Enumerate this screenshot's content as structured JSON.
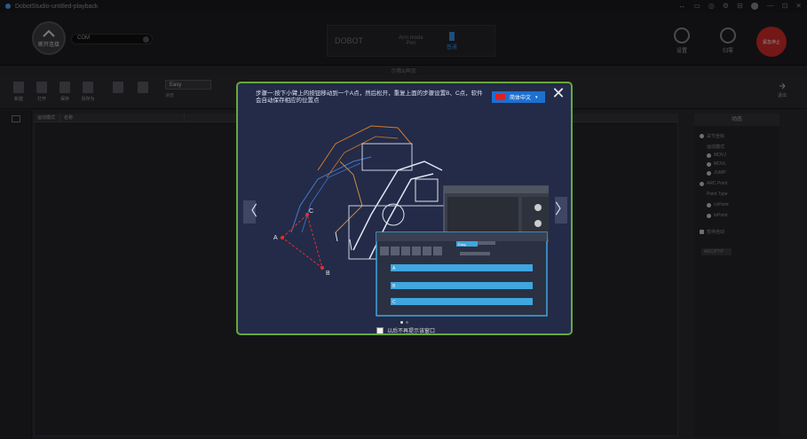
{
  "window": {
    "title": "DobotStudio-untitled-playback",
    "controls": [
      "↔",
      "▭",
      "◎",
      "⚙",
      "⊟",
      "⬤",
      "—",
      "⊡",
      "✕"
    ]
  },
  "topbar": {
    "connect_label": "断开连接",
    "port_value": "COM",
    "device_logo": "DOBOT",
    "mode_label": "Arm mode",
    "mode_value": "Pen",
    "arm_label": "普通",
    "settings_label": "设置",
    "home_label": "归零",
    "estop_label": "紧急停止",
    "subtitle": "示教&再现"
  },
  "filebar": {
    "new": "新建",
    "open": "打开",
    "save": "保存",
    "saveas": "另存为",
    "mode_value": "Easy",
    "speed_label": "速度",
    "exit_label": "退出"
  },
  "table": {
    "headers": [
      "运动模式",
      "名称"
    ]
  },
  "right_panel": {
    "header": "动态",
    "items": [
      "关节坐标",
      "运动模式",
      "MOVJ",
      "MOVL",
      "JUMP",
      "ARC Point",
      "Point Type",
      "cirPoint",
      "toPoint",
      "暂停自动",
      "ARC/PTP"
    ]
  },
  "modal": {
    "instruction": "步骤一:按下小臂上的按钮移动到一个A点，然后松开，重复上面的步骤设置B、C点，软件会自动保存相应的位置点",
    "language": "简体中文",
    "close_symbol": "✕",
    "prev_symbol": "〈",
    "next_symbol": "〉",
    "point_a": "A",
    "point_b": "B",
    "point_c": "C",
    "mini_mode": "Easy",
    "dont_show": "以后不再提示该窗口"
  }
}
